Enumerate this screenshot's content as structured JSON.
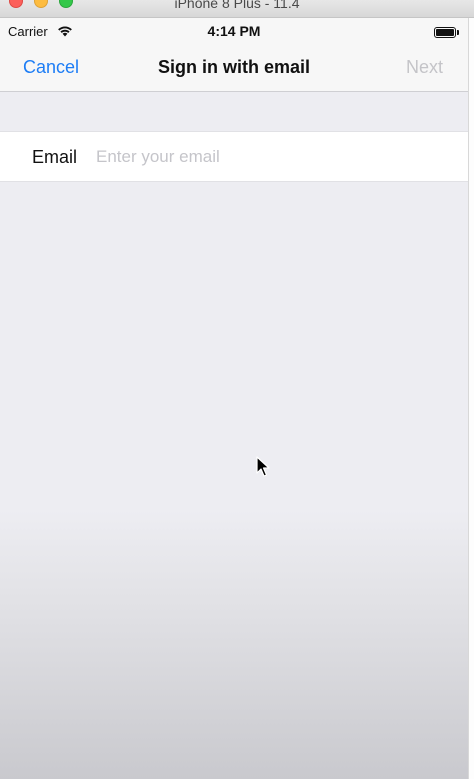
{
  "simulator": {
    "title": "iPhone 8 Plus - 11.4"
  },
  "status_bar": {
    "carrier": "Carrier",
    "time": "4:14 PM"
  },
  "nav": {
    "cancel_label": "Cancel",
    "title": "Sign in with email",
    "next_label": "Next"
  },
  "form": {
    "email_label": "Email",
    "email_placeholder": "Enter your email",
    "email_value": ""
  },
  "colors": {
    "accent": "#1d7df5",
    "disabled": "#c4c4c8",
    "background": "#ededf2"
  }
}
